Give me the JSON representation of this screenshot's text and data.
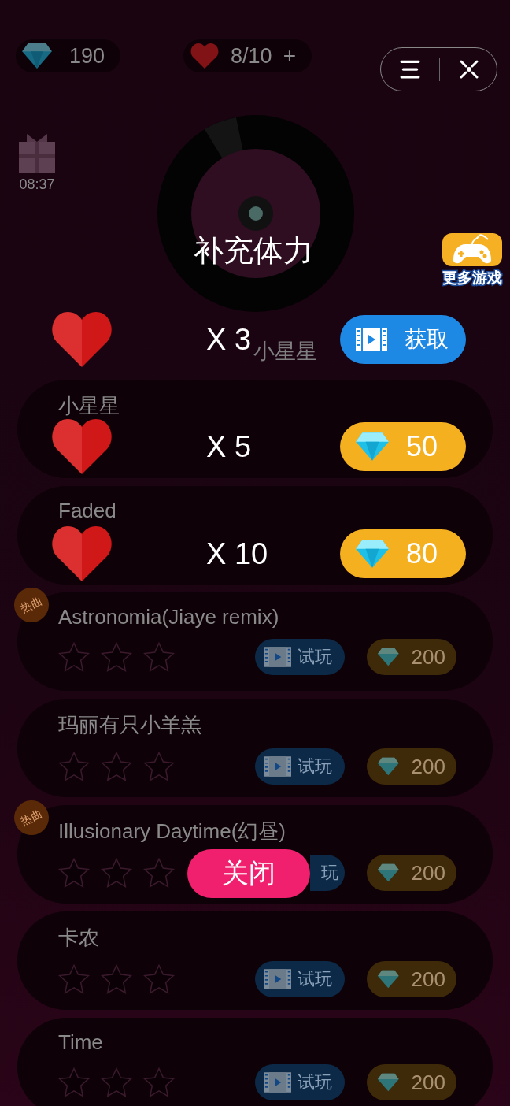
{
  "status": {
    "gems": "190",
    "lives": "8/10",
    "add_lives": "+"
  },
  "gift_timer": "08:37",
  "more_games": "更多游戏",
  "now_playing": "小星星",
  "songs": [
    {
      "title": "小星星"
    },
    {
      "title": "Faded"
    },
    {
      "title": "Astronomia(Jiaye remix)",
      "badge": "热曲",
      "stars": 0,
      "trial_label": "试玩",
      "trial_partial": false,
      "price": "200"
    },
    {
      "title": "玛丽有只小羊羔",
      "stars": 0,
      "trial_label": "试玩",
      "trial_partial": false,
      "price": "200"
    },
    {
      "title": "Illusionary Daytime(幻昼)",
      "badge": "热曲",
      "stars": 0,
      "trial_label": "玩",
      "trial_partial": true,
      "price": "200"
    },
    {
      "title": "卡农",
      "stars": 0,
      "trial_label": "试玩",
      "trial_partial": false,
      "price": "200"
    },
    {
      "title": "Time",
      "stars": 0,
      "trial_label": "试玩",
      "trial_partial": false,
      "price": "200"
    }
  ],
  "refill_dialog": {
    "title": "补充体力",
    "offers": [
      {
        "amount": "X 3",
        "kind": "video",
        "action": "获取"
      },
      {
        "amount": "X 5",
        "kind": "gems",
        "action": "50"
      },
      {
        "amount": "X 10",
        "kind": "gems",
        "action": "80"
      }
    ],
    "close_label": "关闭"
  }
}
